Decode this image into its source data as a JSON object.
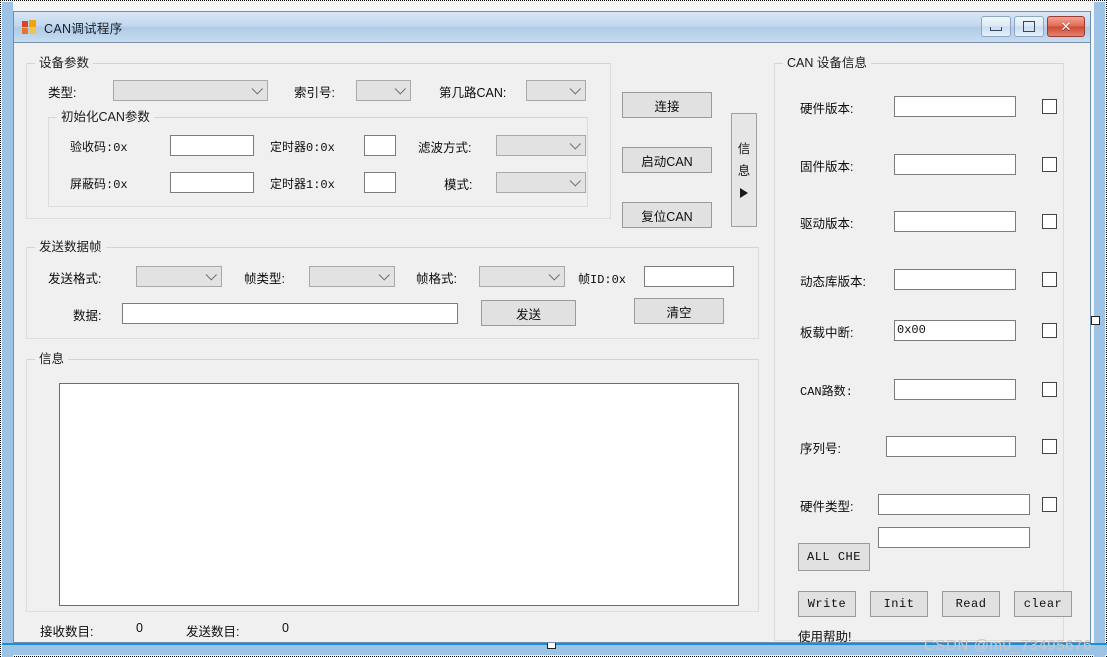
{
  "window": {
    "title": "CAN调试程序",
    "icon": "app-squares-icon",
    "buttons": {
      "minimize": "minimize-icon",
      "maximize": "maximize-icon",
      "close": "✕"
    }
  },
  "device_params": {
    "title": "设备参数",
    "type_label": "类型:",
    "type_value": "",
    "index_label": "索引号:",
    "index_value": "",
    "can_channel_label": "第几路CAN:",
    "can_channel_value": "",
    "init_group": {
      "title": "初始化CAN参数",
      "acceptance_code_label": "验收码:0x",
      "acceptance_code_value": "",
      "mask_code_label": "屏蔽码:0x",
      "mask_code_value": "",
      "timer0_label": "定时器0:0x",
      "timer0_value": "",
      "timer1_label": "定时器1:0x",
      "timer1_value": "",
      "filter_label": "滤波方式:",
      "filter_value": "",
      "mode_label": "模式:",
      "mode_value": ""
    }
  },
  "actions": {
    "connect": "连接",
    "start_can": "启动CAN",
    "reset_can": "复位CAN",
    "info_splitter_char1": "信",
    "info_splitter_char2": "息"
  },
  "send_frame": {
    "title": "发送数据帧",
    "send_format_label": "发送格式:",
    "send_format_value": "",
    "frame_type_label": "帧类型:",
    "frame_type_value": "",
    "frame_format_label": "帧格式:",
    "frame_format_value": "",
    "frame_id_label": "帧ID:0x",
    "frame_id_value": "",
    "data_label": "数据:",
    "data_value": "",
    "send_button": "发送",
    "clear_button": "清空"
  },
  "message": {
    "title": "信息",
    "log_value": ""
  },
  "status": {
    "recv_label": "接收数目:",
    "recv_value": "0",
    "sent_label": "发送数目:",
    "sent_value": "0"
  },
  "can_info": {
    "title": "CAN 设备信息",
    "rows": [
      {
        "label": "硬件版本:",
        "value": ""
      },
      {
        "label": "固件版本:",
        "value": ""
      },
      {
        "label": "驱动版本:",
        "value": ""
      },
      {
        "label": "动态库版本:",
        "value": ""
      },
      {
        "label": "板载中断:",
        "value": "0x00"
      },
      {
        "label": "CAN路数:",
        "value": ""
      },
      {
        "label": "序列号:",
        "value": ""
      },
      {
        "label": "硬件类型:",
        "value": ""
      }
    ],
    "extra_value": "",
    "all_che_button": "ALL CHE",
    "write_button": "Write",
    "init_button": "Init",
    "read_button": "Read",
    "clear_button": "clear",
    "help_text": "使用帮助!"
  },
  "watermark": "CSDN @m0_73495676"
}
